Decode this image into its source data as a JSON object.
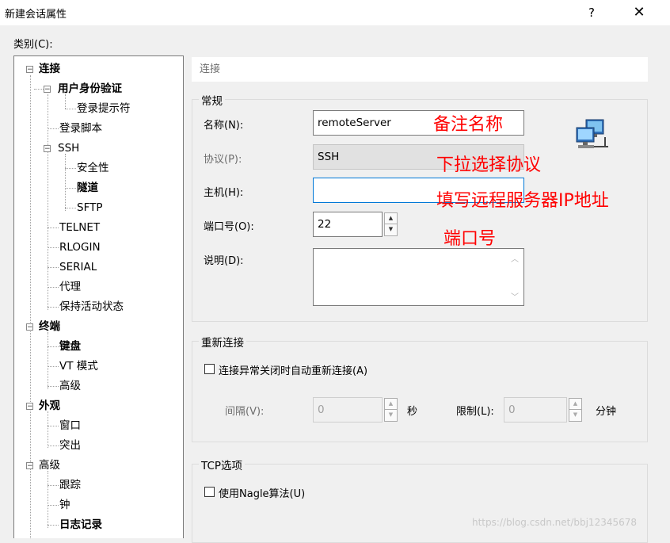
{
  "window": {
    "title": "新建会话属性",
    "help": "?",
    "close": "✕"
  },
  "category_label": "类别(C):",
  "tree": [
    {
      "label": "连接"
    },
    {
      "label": "用户身份验证"
    },
    {
      "label": "登录提示符"
    },
    {
      "label": "登录脚本"
    },
    {
      "label": "SSH"
    },
    {
      "label": "安全性"
    },
    {
      "label": "隧道"
    },
    {
      "label": "SFTP"
    },
    {
      "label": "TELNET"
    },
    {
      "label": "RLOGIN"
    },
    {
      "label": "SERIAL"
    },
    {
      "label": "代理"
    },
    {
      "label": "保持活动状态"
    },
    {
      "label": "终端"
    },
    {
      "label": "键盘"
    },
    {
      "label": "VT 模式"
    },
    {
      "label": "高级"
    },
    {
      "label": "外观"
    },
    {
      "label": "窗口"
    },
    {
      "label": "突出"
    },
    {
      "label": "高级"
    },
    {
      "label": "跟踪"
    },
    {
      "label": "钟"
    },
    {
      "label": "日志记录"
    }
  ],
  "section_title": "连接",
  "general": {
    "title": "常规",
    "name_label": "名称(N):",
    "name_value": "remoteServer",
    "protocol_label": "协议(P):",
    "protocol_value": "SSH",
    "host_label": "主机(H):",
    "host_value": "",
    "port_label": "端口号(O):",
    "port_value": "22",
    "desc_label": "说明(D):",
    "desc_value": ""
  },
  "reconnect": {
    "title": "重新连接",
    "checkbox_label": "连接异常关闭时自动重新连接(A)",
    "interval_label": "间隔(V):",
    "interval_value": "0",
    "seconds_unit": "秒",
    "limit_label": "限制(L):",
    "limit_value": "0",
    "minutes_unit": "分钟"
  },
  "tcp": {
    "title": "TCP选项",
    "nagle_label": "使用Nagle算法(U)"
  },
  "annotations": {
    "name": "备注名称",
    "protocol": "下拉选择协议",
    "host": "填写远程服务器IP地址",
    "port": "端口号"
  },
  "watermark": "https://blog.csdn.net/bbj12345678"
}
